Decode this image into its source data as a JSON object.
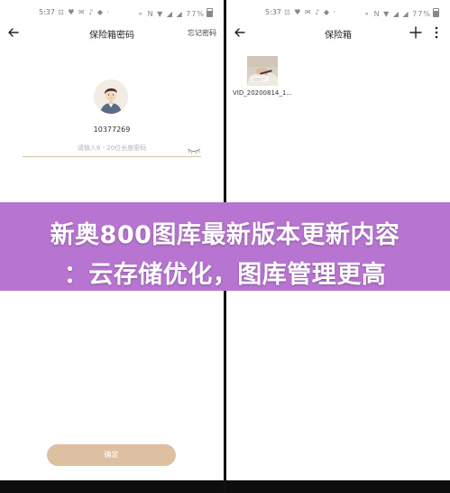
{
  "status_bar": {
    "left_time": "5:37",
    "left_notifs": "⊡ ♥ ✉ ♪ ◆ ·",
    "left_battery": "77%",
    "right_time": "5:37",
    "right_notifs": "⊡ ♥ ✉ ♪ ◆ ·",
    "right_battery": "77%",
    "system_icons": "⚬ N ▼ ◢ ◢"
  },
  "left_screen": {
    "title": "保险箱密码",
    "forgot_password": "忘记密码",
    "user_id": "10377269",
    "password_placeholder": "请输入6 - 20位长度密码",
    "confirm_label": "确定"
  },
  "right_screen": {
    "title": "保险箱",
    "file_name": "VID_20200814_1..."
  },
  "banner": {
    "line1": "新奥800图库最新版本更新内容",
    "line2": "：云存储优化，图库管理更高"
  },
  "colors": {
    "accent_gold": "#dcc0a1",
    "banner_purple": "#b774d1"
  }
}
